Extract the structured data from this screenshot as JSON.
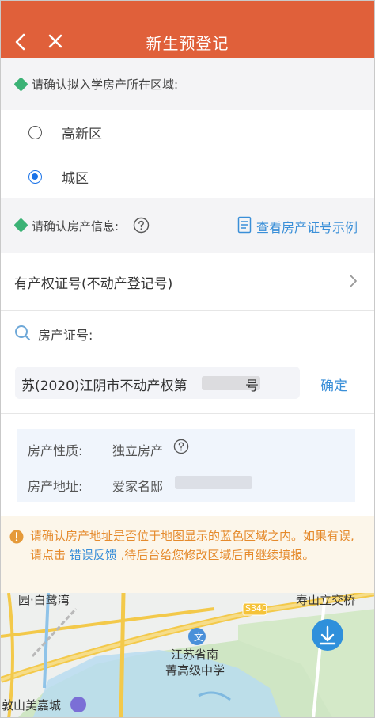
{
  "header": {
    "title": "新生预登记",
    "back_icon": "chevron-left-icon",
    "close_icon": "close-icon",
    "color": "#e0603a"
  },
  "district_section": {
    "label": "请确认拟入学房产所在区域:",
    "options": [
      {
        "label": "高新区",
        "checked": false
      },
      {
        "label": "城区",
        "checked": true
      }
    ]
  },
  "property_section": {
    "label": "请确认房产信息:",
    "help_icon": "question-circle-icon",
    "example_link": "查看房产证号示例",
    "example_icon": "document-icon"
  },
  "certificate_type": {
    "label": "有产权证号(不动产登记号)"
  },
  "cert_search": {
    "label": "房产证号:",
    "value_prefix": "苏(2020)江阴市不动产权第",
    "value_suffix": "号",
    "confirm_label": "确定"
  },
  "property_info": {
    "nature_label": "房产性质:",
    "nature_value": "独立房产",
    "address_label": "房产地址:",
    "address_value": "爱家名邸"
  },
  "notice": {
    "text_before": "请确认房产地址是否位于地图显示的蓝色区域之内。如果有误,请点击",
    "error_link": "错误反馈",
    "text_after": ",待后台给您修改区域后再继续填报。",
    "color": "#e58a2c"
  },
  "map": {
    "labels": {
      "place1": "园·白鹭湾",
      "place2": "寿山立交桥",
      "road": "S340",
      "school_line1": "江苏省南",
      "school_line2": "菁高级中学",
      "place3": "敦山美嘉城"
    },
    "download_icon": "download-icon"
  }
}
